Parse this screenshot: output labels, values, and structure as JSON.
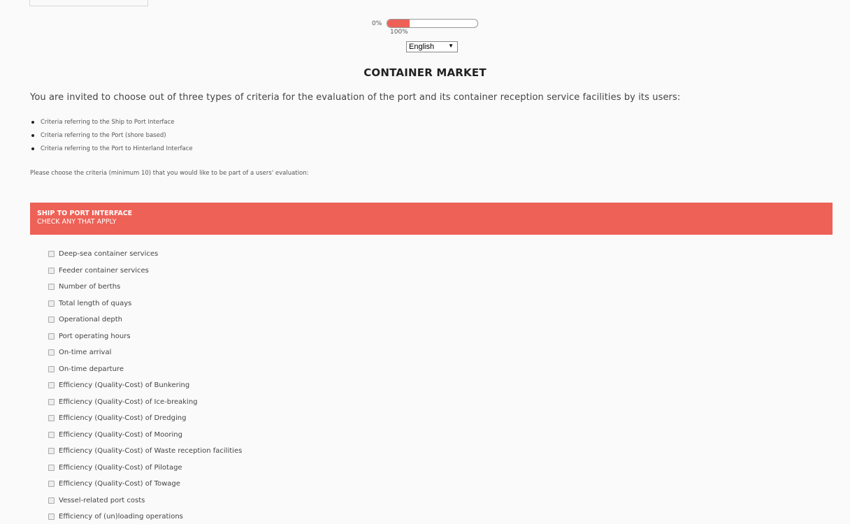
{
  "progress": {
    "min_label": "0%",
    "max_label": "100%",
    "fill_fraction": 0.25,
    "fill_color": "#ee6157"
  },
  "language": {
    "selected": "English"
  },
  "title": "CONTAINER MARKET",
  "intro": "You are invited to choose out of three types of criteria for the evaluation of the port and its container reception service facilities by its users:",
  "bullets": [
    "Criteria referring to the Ship to Port Interface",
    "Criteria referring to the Port (shore based)",
    "Criteria referring to the Port to Hinterland Interface"
  ],
  "prompt": "Please choose the criteria (minimum 10) that you would like to be part of a users' evaluation:",
  "section": {
    "title": "SHIP TO PORT INTERFACE",
    "subtitle": "CHECK ANY THAT APPLY",
    "color": "#ee6157"
  },
  "options": [
    "Deep-sea container services",
    "Feeder container services",
    "Number of berths",
    "Total length of quays",
    "Operational depth",
    "Port operating hours",
    "On-time arrival",
    "On-time departure",
    "Efficiency (Quality-Cost) of Bunkering",
    "Efficiency (Quality-Cost) of Ice-breaking",
    "Efficiency (Quality-Cost) of Dredging",
    "Efficiency (Quality-Cost) of Mooring",
    "Efficiency (Quality-Cost) of Waste reception facilities",
    "Efficiency (Quality-Cost) of Pilotage",
    "Efficiency (Quality-Cost) of Towage",
    "Vessel-related port costs",
    "Efficiency of (un)loading operations"
  ]
}
